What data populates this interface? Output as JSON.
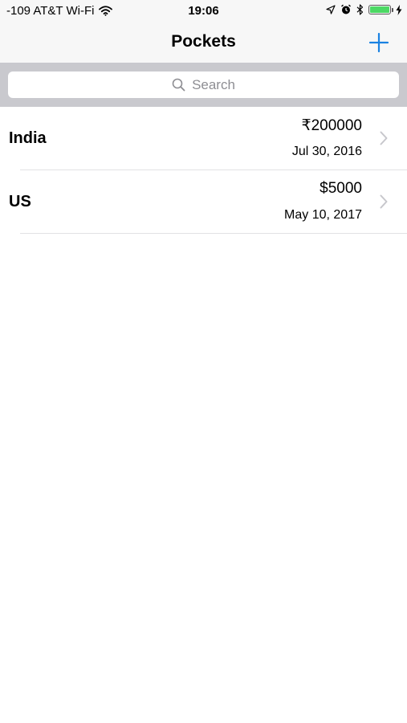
{
  "status_bar": {
    "carrier": "-109 AT&T Wi-Fi",
    "time": "19:06",
    "battery_level": 1.0,
    "battery_color": "#4cd964"
  },
  "nav": {
    "title": "Pockets",
    "add_icon": "plus-icon",
    "accent": "#1a82e2"
  },
  "search": {
    "placeholder": "Search",
    "icon": "search-icon"
  },
  "pockets": [
    {
      "name": "India",
      "amount": "₹200000",
      "date": "Jul 30, 2016"
    },
    {
      "name": "US",
      "amount": "$5000",
      "date": "May 10, 2017"
    }
  ]
}
